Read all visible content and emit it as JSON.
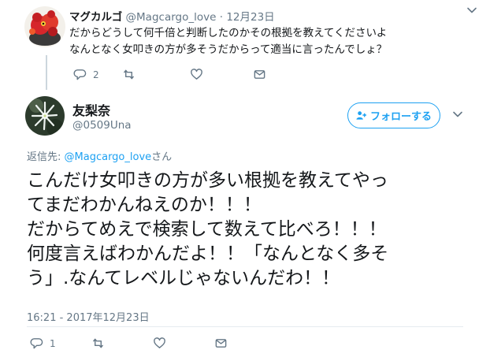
{
  "parent_tweet": {
    "name": "マグカルゴ",
    "handle": "@Magcargo_love",
    "separator": "·",
    "date": "12月23日",
    "text_line1": "だからどうして何千倍と判断したのかその根拠を教えてくださいよ",
    "text_line2": "なんとなく女叩きの方が多そうだからって適当に言ったんでしょ？",
    "reply_count": "2",
    "retweet_count": "",
    "like_count": ""
  },
  "main_tweet": {
    "name": "友梨奈",
    "handle": "@0509Una",
    "follow_label": "フォローする",
    "reply_prefix": "返信先: ",
    "reply_to": "@Magcargo_love",
    "reply_suffix": "さん",
    "text_lines": [
      "こんだけ女叩きの方が多い根拠を教えてやっ",
      "てまだわかんねえのか！！！",
      "だからてめえで検索して数えて比べろ！！！",
      "何度言えばわかんだよ！！「なんとなく多そ",
      "う」.なんてレベルじゃないんだわ！！"
    ],
    "timestamp": "16:21 - 2017年12月23日",
    "reply_count": "1",
    "retweet_count": "",
    "like_count": ""
  },
  "colors": {
    "accent": "#1da1f2",
    "muted": "#657786",
    "text": "#14171a",
    "thread_line": "#ccd6dd"
  },
  "icons": [
    "reply-icon",
    "retweet-icon",
    "heart-icon",
    "dm-envelope-icon",
    "chevron-down-icon",
    "add-user-icon"
  ]
}
